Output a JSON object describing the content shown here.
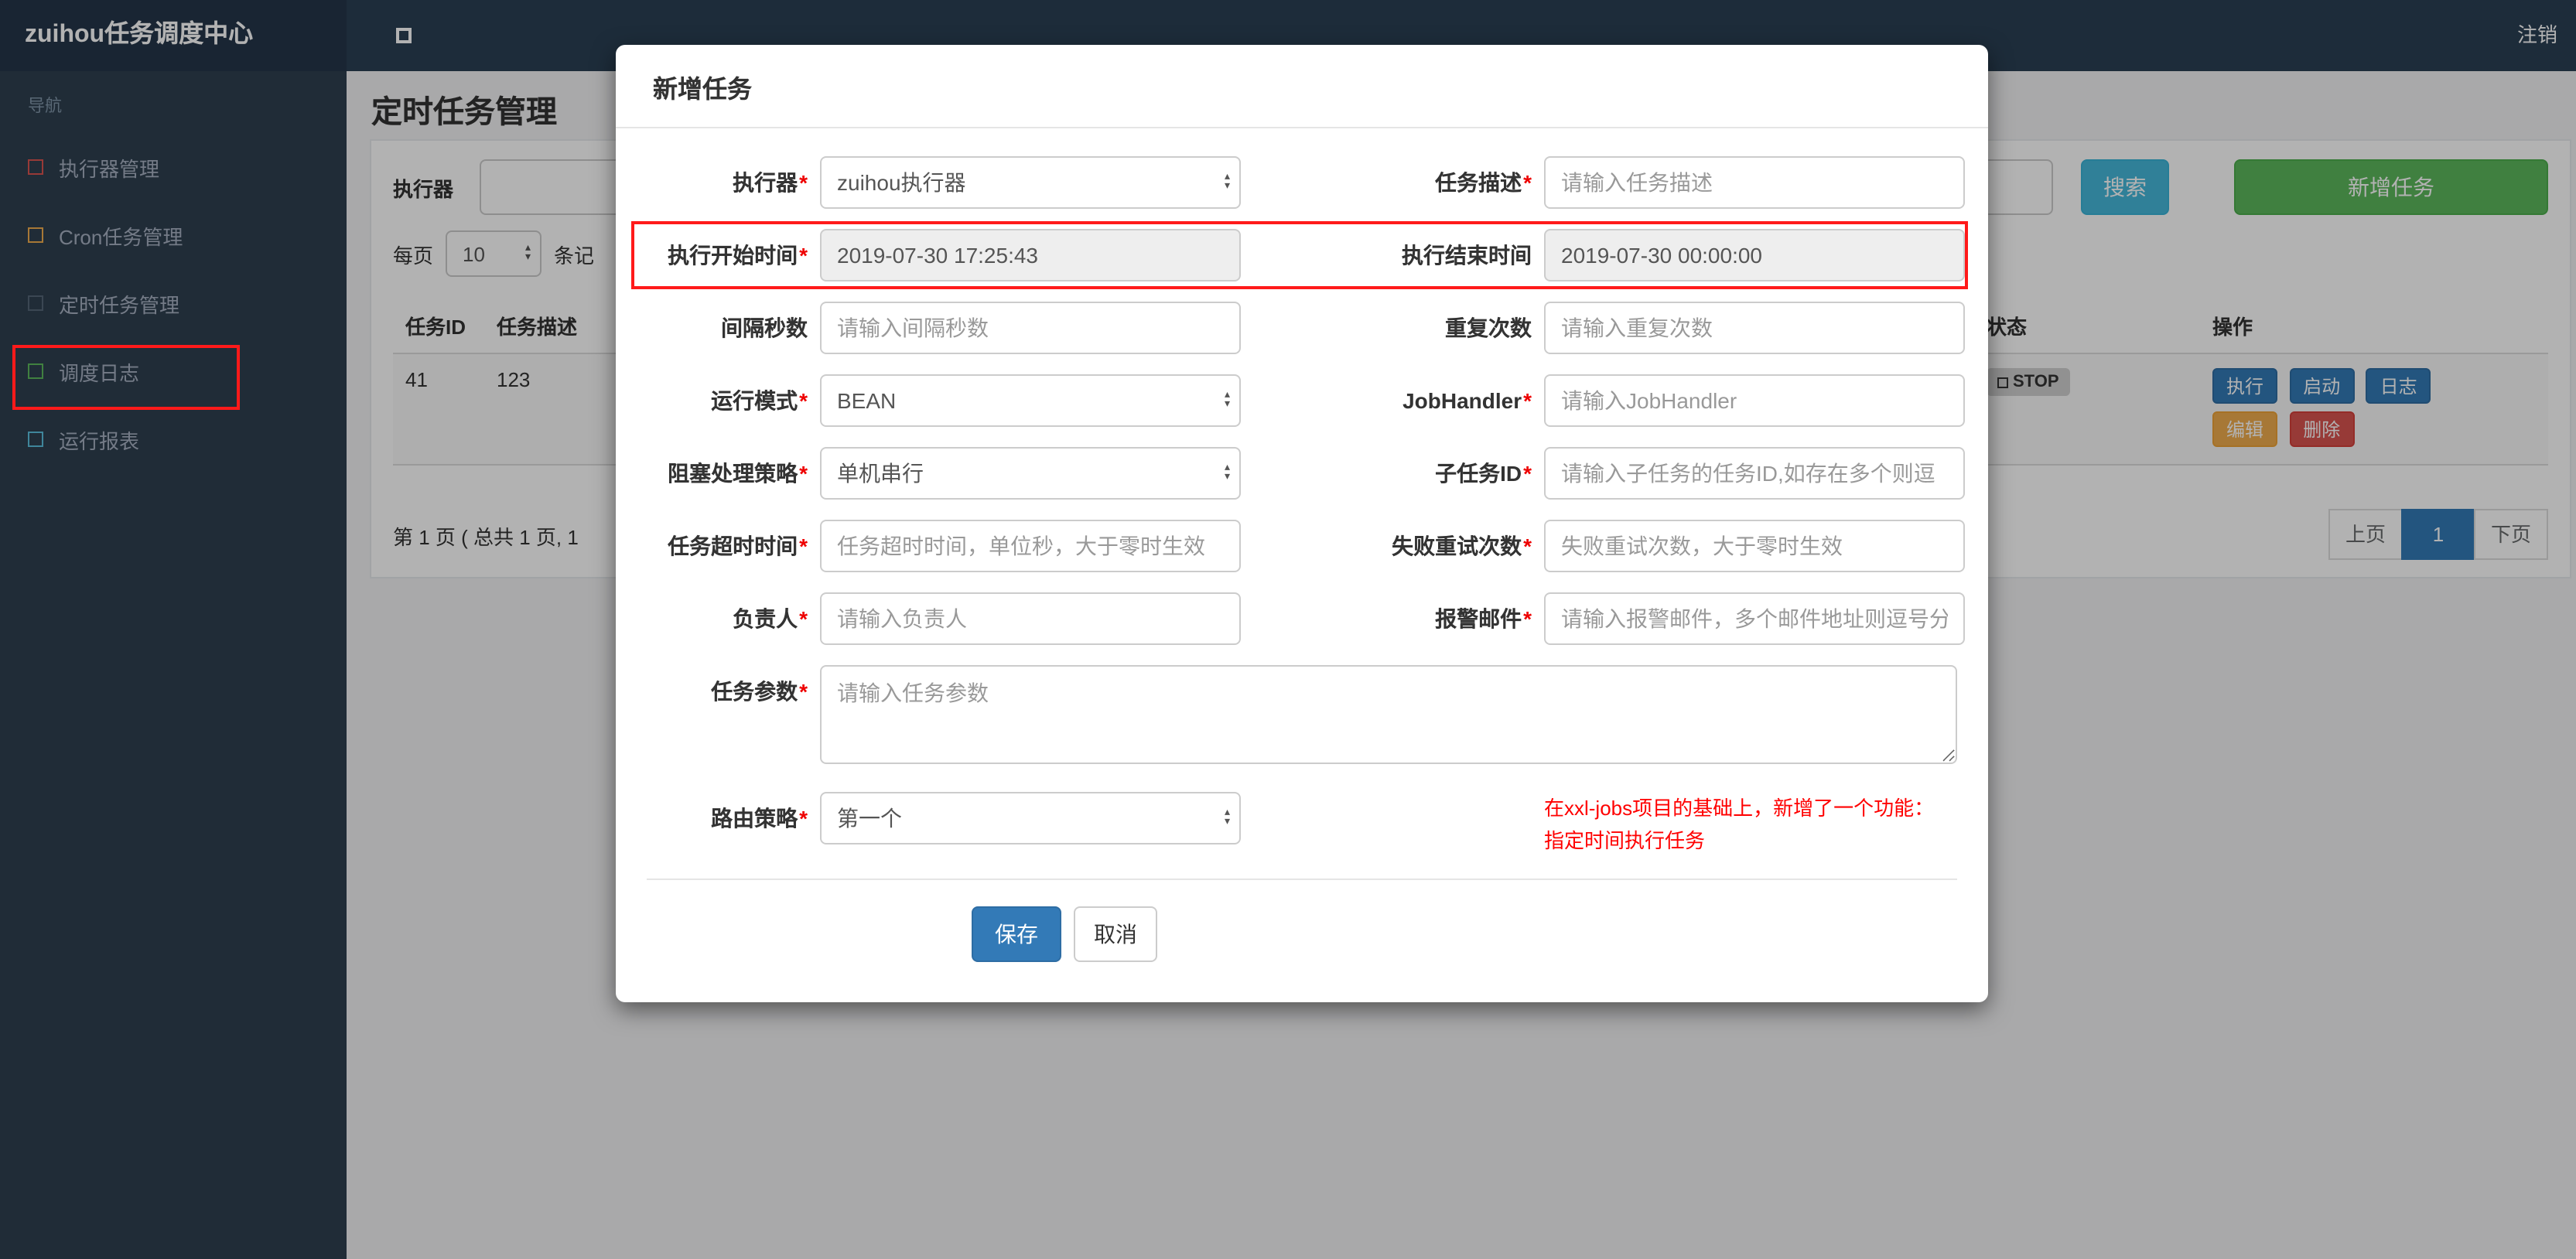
{
  "colors": {
    "navbar_bg": "#2a3f54",
    "sidebar_bg": "#2f4050",
    "search_btn": "#46b8da",
    "add_btn": "#5cb85c",
    "primary_btn": "#337ab7",
    "edit_btn": "#f0ad4e",
    "delete_btn": "#d9534f",
    "annotation_red": "#ff1a1a",
    "note_red": "#ff0000"
  },
  "navbar": {
    "brand": "zuihou任务调度中心",
    "logout": "注销"
  },
  "sidebar": {
    "section": "导航",
    "items": [
      {
        "label": "执行器管理",
        "icon_color": "#d9534f"
      },
      {
        "label": "Cron任务管理",
        "icon_color": "#f0ad4e"
      },
      {
        "label": "定时任务管理",
        "icon_color": "#556677"
      },
      {
        "label": "调度日志",
        "icon_color": "#5cb85c"
      },
      {
        "label": "运行报表",
        "icon_color": "#5bc0de"
      }
    ]
  },
  "page": {
    "title": "定时任务管理",
    "filter": {
      "label": "执行器",
      "search": "搜索",
      "add": "新增任务"
    },
    "per_page": {
      "prefix": "每页",
      "value": "10",
      "suffix": "条记"
    },
    "table": {
      "headers": {
        "id": "任务ID",
        "desc": "任务描述",
        "status": "状态",
        "actions": "操作"
      },
      "row": {
        "id": "41",
        "desc": "123",
        "status": "STOP",
        "actions": {
          "run": "执行",
          "start": "启动",
          "log": "日志",
          "edit": "编辑",
          "delete": "删除"
        }
      }
    },
    "pagination": {
      "summary": "第 1 页 ( 总共 1 页, 1",
      "prev": "上页",
      "current": "1",
      "next": "下页"
    }
  },
  "modal": {
    "title": "新增任务",
    "req_mark": "*",
    "fields": {
      "executor": {
        "label": "执行器",
        "value": "zuihou执行器"
      },
      "desc": {
        "label": "任务描述",
        "placeholder": "请输入任务描述"
      },
      "start_time": {
        "label": "执行开始时间",
        "value": "2019-07-30 17:25:43"
      },
      "end_time": {
        "label": "执行结束时间",
        "value": "2019-07-30 00:00:00"
      },
      "interval": {
        "label": "间隔秒数",
        "placeholder": "请输入间隔秒数"
      },
      "repeat": {
        "label": "重复次数",
        "placeholder": "请输入重复次数"
      },
      "run_mode": {
        "label": "运行模式",
        "value": "BEAN"
      },
      "job_handler": {
        "label": "JobHandler",
        "placeholder": "请输入JobHandler"
      },
      "block_strategy": {
        "label": "阻塞处理策略",
        "value": "单机串行"
      },
      "child_job": {
        "label": "子任务ID",
        "placeholder": "请输入子任务的任务ID,如存在多个则逗"
      },
      "timeout": {
        "label": "任务超时时间",
        "placeholder": "任务超时时间，单位秒，大于零时生效"
      },
      "retry": {
        "label": "失败重试次数",
        "placeholder": "失败重试次数，大于零时生效"
      },
      "owner": {
        "label": "负责人",
        "placeholder": "请输入负责人"
      },
      "alarm_email": {
        "label": "报警邮件",
        "placeholder": "请输入报警邮件，多个邮件地址则逗号分"
      },
      "params": {
        "label": "任务参数",
        "placeholder": "请输入任务参数"
      },
      "route_strategy": {
        "label": "路由策略",
        "value": "第一个"
      }
    },
    "note_line1": "在xxl-jobs项目的基础上，新增了一个功能：",
    "note_line2": "指定时间执行任务",
    "save": "保存",
    "cancel": "取消"
  }
}
